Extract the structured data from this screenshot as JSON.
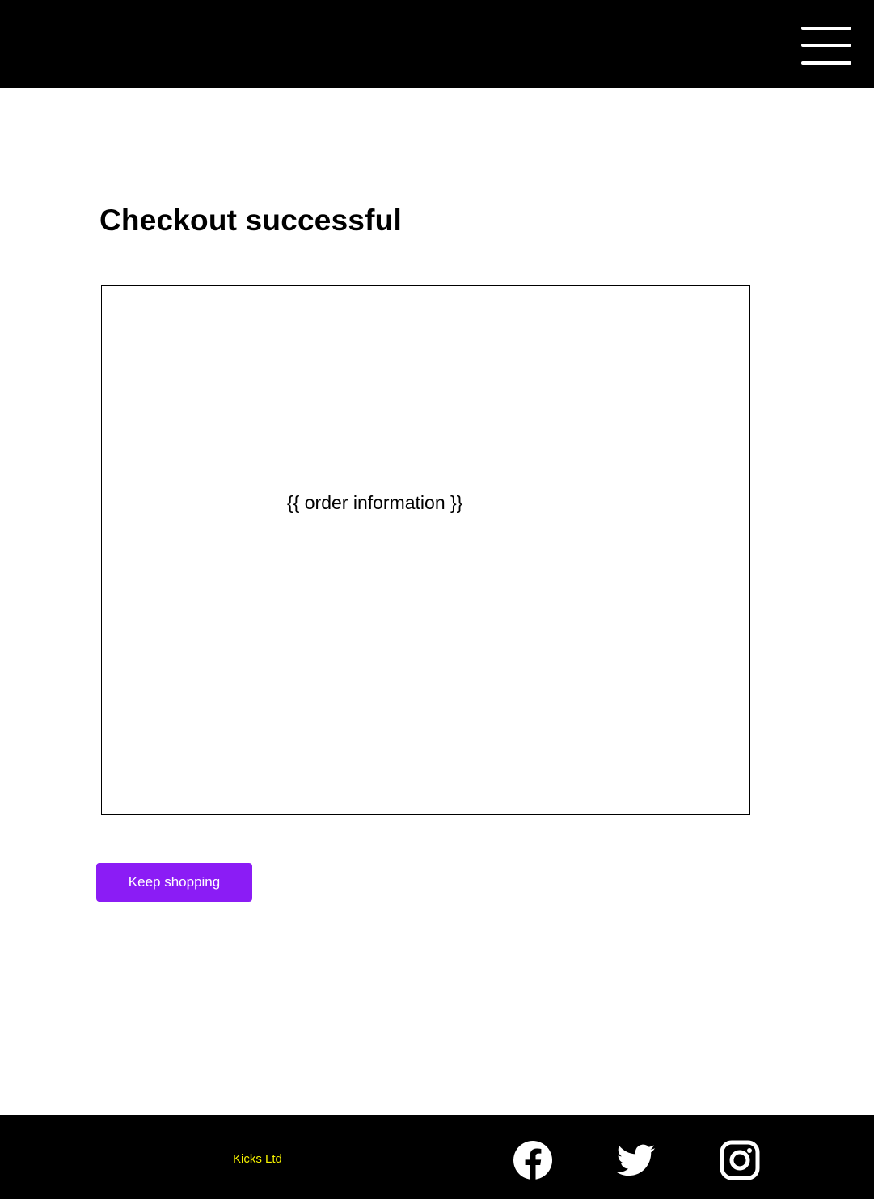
{
  "header": {
    "menu_icon": "hamburger-menu-icon"
  },
  "main": {
    "title": "Checkout successful",
    "order_placeholder": "{{ order information }}",
    "keep_shopping_label": "Keep shopping"
  },
  "footer": {
    "brand": "Kicks Ltd",
    "social": [
      {
        "icon": "facebook-icon"
      },
      {
        "icon": "twitter-icon"
      },
      {
        "icon": "instagram-icon"
      }
    ]
  },
  "colors": {
    "header_bg": "#000000",
    "footer_bg": "#000000",
    "button_bg": "#8b1cf5",
    "brand_text": "#f5f100"
  }
}
